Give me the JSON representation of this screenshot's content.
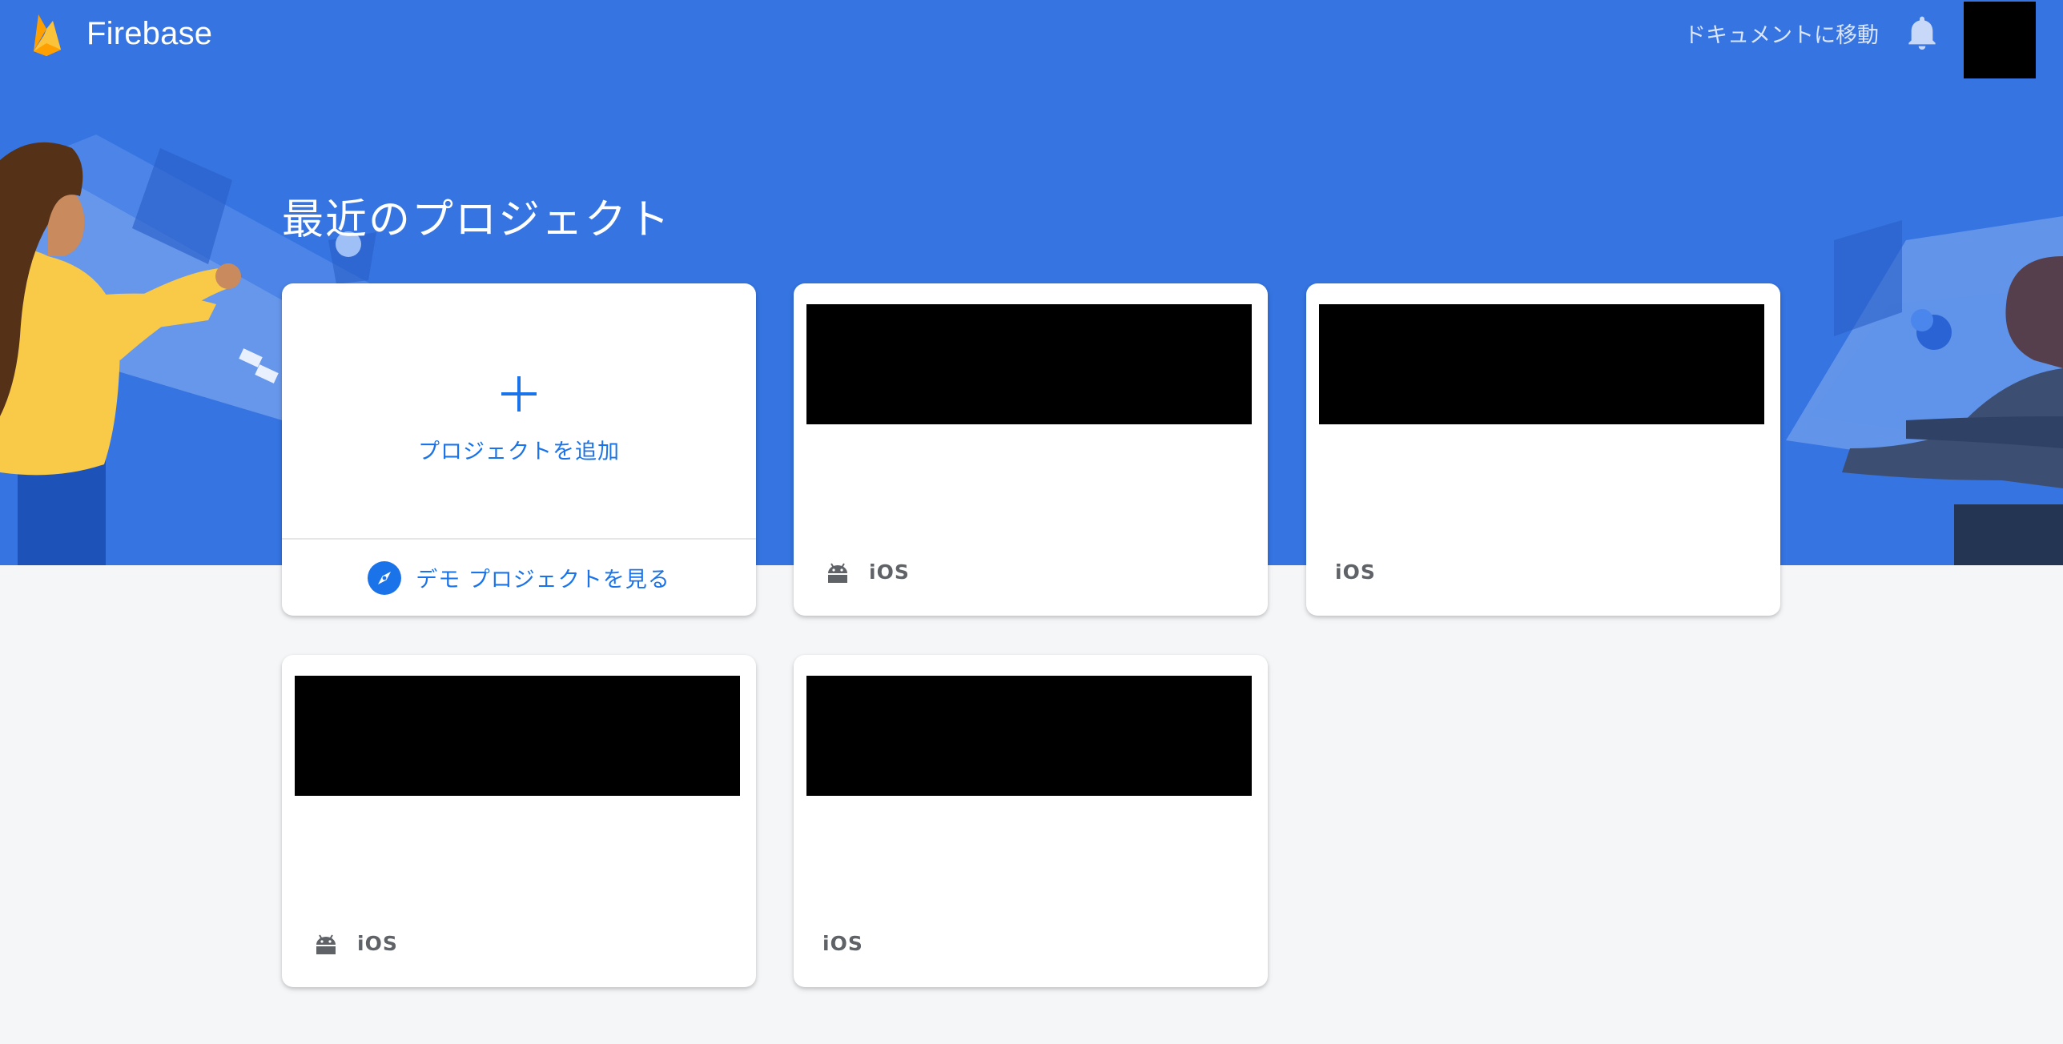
{
  "header": {
    "brand_name": "Firebase",
    "brand_logo_icon": "firebase-flame-icon",
    "docs_link": "ドキュメントに移動",
    "notifications_icon": "bell-icon"
  },
  "colors": {
    "hero_background": "#3574e1",
    "page_background": "#f5f6f8",
    "accent": "#1a73e8",
    "card_background": "#ffffff"
  },
  "main": {
    "title": "最近のプロジェクト",
    "add_project": {
      "icon": "plus-icon",
      "label": "プロジェクトを追加"
    },
    "demo_project": {
      "icon": "compass-icon",
      "label": "デモ プロジェクトを見る"
    },
    "projects": [
      {
        "name_redacted": true,
        "platforms": [
          "android",
          "iOS"
        ],
        "ios_label": "iOS"
      },
      {
        "name_redacted": true,
        "platforms": [
          "iOS"
        ],
        "ios_label": "iOS"
      },
      {
        "name_redacted": true,
        "platforms": [
          "android",
          "iOS"
        ],
        "ios_label": "iOS"
      },
      {
        "name_redacted": true,
        "platforms": [
          "iOS"
        ],
        "ios_label": "iOS"
      }
    ]
  }
}
